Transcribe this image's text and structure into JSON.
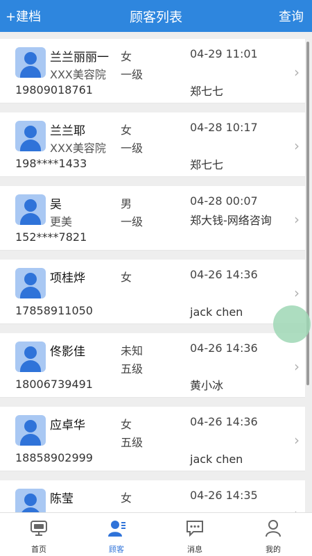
{
  "header": {
    "left": "+建档",
    "title": "顾客列表",
    "right": "查询"
  },
  "customers": [
    {
      "name": "兰兰丽丽一",
      "org": "XXX美容院",
      "gender": "女",
      "level": "一级",
      "time": "04-29 11:01",
      "phone": "19809018761",
      "staff": "郑七七"
    },
    {
      "name": "兰兰耶",
      "org": "XXX美容院",
      "gender": "女",
      "level": "一级",
      "time": "04-28 10:17",
      "phone": "198****1433",
      "staff": "郑七七"
    },
    {
      "name": "吴",
      "org": "更美",
      "gender": "男",
      "level": "一级",
      "time": "04-28 00:07",
      "phone": "152****7821",
      "staff": "郑大钱-网络咨询"
    },
    {
      "name": "项桂烨",
      "org": "",
      "gender": "女",
      "level": "",
      "time": "04-26 14:36",
      "phone": "17858911050",
      "staff": "jack chen"
    },
    {
      "name": "佟影佳",
      "org": "",
      "gender": "未知",
      "level": "五级",
      "time": "04-26 14:36",
      "phone": "18006739491",
      "staff": "黄小冰"
    },
    {
      "name": "应卓华",
      "org": "",
      "gender": "女",
      "level": "五级",
      "time": "04-26 14:36",
      "phone": "18858902999",
      "staff": "jack chen"
    },
    {
      "name": "陈莹",
      "org": "",
      "gender": "女",
      "level": "",
      "time": "04-26 14:35",
      "phone": "",
      "staff": ""
    }
  ],
  "tabs": [
    {
      "label": "首页",
      "icon": "home-monitor-icon"
    },
    {
      "label": "顾客",
      "icon": "customer-icon",
      "active": true
    },
    {
      "label": "消息",
      "icon": "message-icon"
    },
    {
      "label": "我的",
      "icon": "profile-icon"
    }
  ],
  "colors": {
    "header": "#2e86de",
    "accent": "#2f73d9",
    "fab": "#9fd7b5"
  }
}
